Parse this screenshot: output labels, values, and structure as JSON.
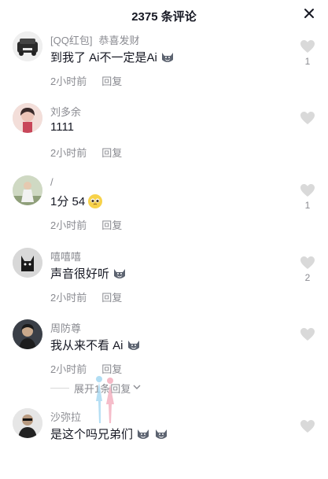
{
  "header": {
    "title": "2375 条评论"
  },
  "comments": [
    {
      "tag": "[QQ红包]",
      "tag2": "恭喜发财",
      "name": "",
      "text": "到我了 Ai不一定是Ai",
      "time": "2小时前",
      "reply": "回复",
      "likes": "1"
    },
    {
      "name": "刘多余",
      "text": "1111",
      "time": "2小时前",
      "reply": "回复",
      "likes": ""
    },
    {
      "name": "/",
      "text": "1分 54",
      "time": "2小时前",
      "reply": "回复",
      "likes": "1"
    },
    {
      "name": "嘻嘻嘻",
      "text": "声音很好听",
      "time": "2小时前",
      "reply": "回复",
      "likes": "2"
    },
    {
      "name": "周防尊",
      "text": "我从来不看 Ai",
      "time": "2小时前",
      "reply": "回复",
      "likes": ""
    },
    {
      "name": "沙弥拉",
      "text": "是这个吗兄弟们",
      "time": "",
      "reply": "",
      "likes": ""
    }
  ],
  "expand": {
    "label": "展开1条回复"
  },
  "colors": {
    "text": "#161823",
    "secondary": "#8a8b91",
    "like_icon": "#d9d9d9"
  }
}
